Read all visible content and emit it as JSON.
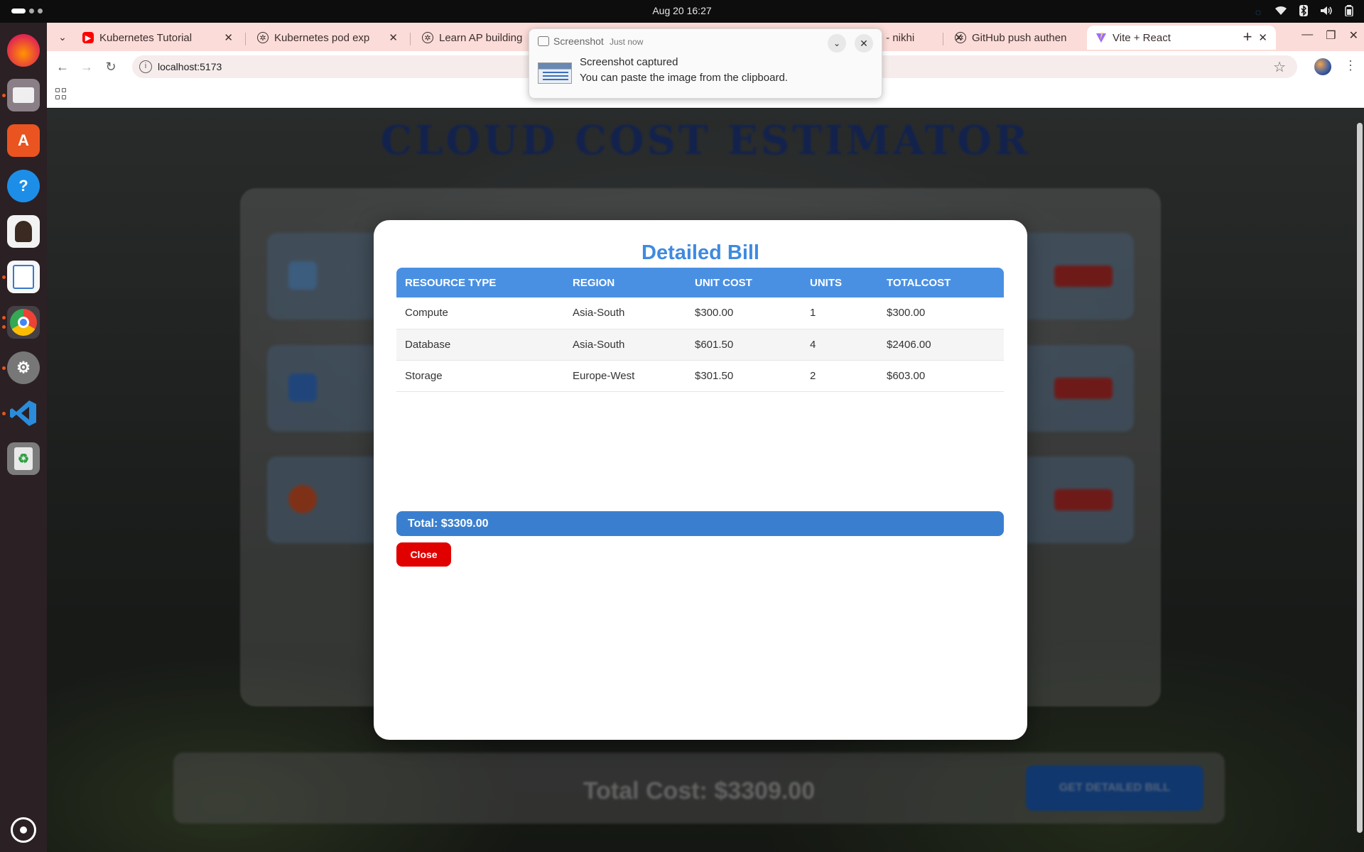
{
  "system": {
    "clock": "Aug 20  16:27",
    "tray_icons": [
      "network-icon",
      "wifi-icon",
      "bluetooth-icon",
      "volume-icon",
      "battery-icon"
    ]
  },
  "dock": {
    "items": [
      {
        "name": "firefox-icon",
        "color": "#e66000"
      },
      {
        "name": "files-icon",
        "color": "#8a7f86"
      },
      {
        "name": "app-center-icon",
        "color": "#e95420"
      },
      {
        "name": "help-icon",
        "color": "#1d8ee8"
      },
      {
        "name": "app-icon",
        "color": "#3a3a3a"
      },
      {
        "name": "text-editor-icon",
        "color": "#f4c430"
      },
      {
        "name": "chrome-icon",
        "color": "#4285f4"
      },
      {
        "name": "settings-icon",
        "color": "#777777"
      },
      {
        "name": "vscode-icon",
        "color": "#2a8cdb"
      },
      {
        "name": "trash-icon",
        "color": "#8ab06f"
      },
      {
        "name": "show-apps-icon",
        "color": "#ffffff"
      }
    ]
  },
  "browser": {
    "tabs": [
      {
        "label": "Kubernetes Tutorial",
        "favicon": "youtube-icon"
      },
      {
        "label": "Kubernetes pod exp",
        "favicon": "chatgpt-icon"
      },
      {
        "label": "Learn AP building",
        "favicon": "chatgpt-icon"
      },
      {
        "label": "",
        "favicon": "chatgpt-icon"
      },
      {
        "label": ") - nikhi",
        "favicon": ""
      },
      {
        "label": "GitHub push authen",
        "favicon": "chatgpt-icon"
      },
      {
        "label": "Vite + React",
        "favicon": "vite-icon"
      }
    ],
    "active_tab": 6,
    "url": "localhost:5173"
  },
  "notification": {
    "app": "Screenshot",
    "time": "Just now",
    "title": "Screenshot captured",
    "body": "You can paste the image from the clipboard."
  },
  "page": {
    "heading": "CLOUD COST ESTIMATOR",
    "footer_total": "Total Cost: $3309.00",
    "detail_button": "GET DETAILED BILL"
  },
  "modal": {
    "title": "Detailed Bill",
    "columns": [
      "RESOURCE TYPE",
      "REGION",
      "UNIT COST",
      "UNITS",
      "TOTALCOST"
    ],
    "rows": [
      {
        "resource": "Compute",
        "region": "Asia-South",
        "unit_cost": "$300.00",
        "units": "1",
        "total": "$300.00"
      },
      {
        "resource": "Database",
        "region": "Asia-South",
        "unit_cost": "$601.50",
        "units": "4",
        "total": "$2406.00"
      },
      {
        "resource": "Storage",
        "region": "Europe-West",
        "unit_cost": "$301.50",
        "units": "2",
        "total": "$603.00"
      }
    ],
    "total": "Total: $3309.00",
    "close_label": "Close"
  },
  "colors": {
    "accent": "#4a90e2",
    "danger": "#e00000",
    "title": "#3f8ae0"
  }
}
